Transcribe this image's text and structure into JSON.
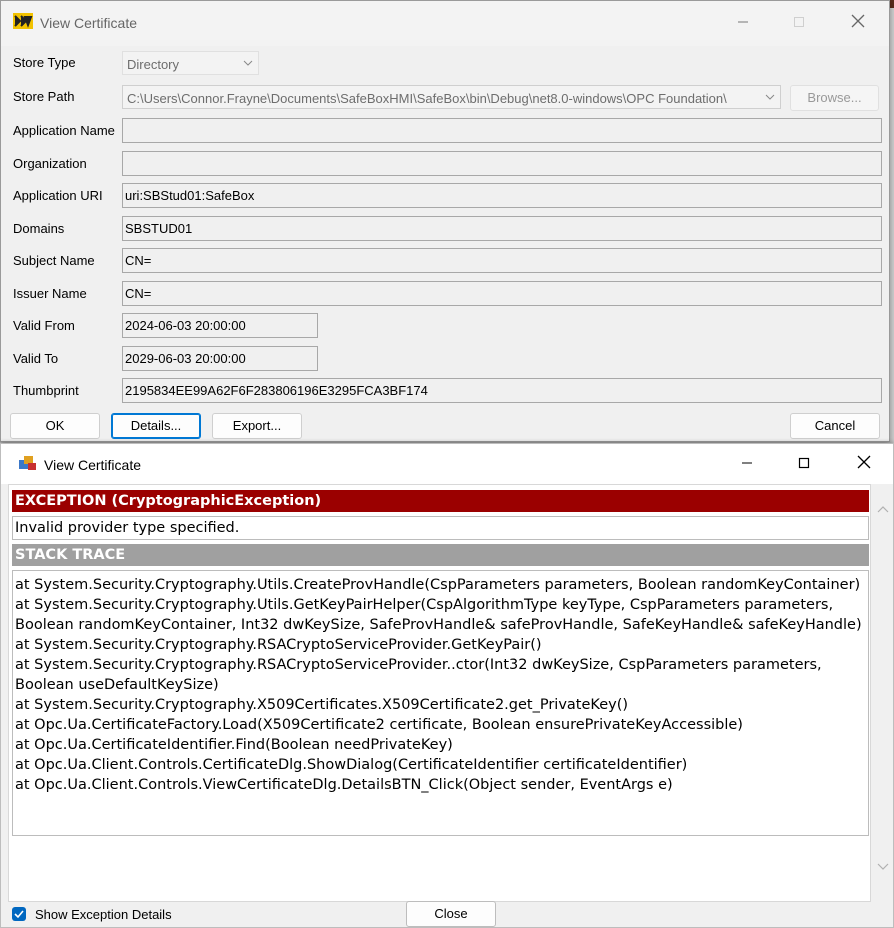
{
  "cert_window": {
    "title": "View Certificate",
    "fields": {
      "store_type": {
        "label": "Store Type",
        "value": "Directory"
      },
      "store_path": {
        "label": "Store Path",
        "value": "C:\\Users\\Connor.Frayne\\Documents\\SafeBoxHMI\\SafeBox\\bin\\Debug\\net8.0-windows\\OPC Foundation\\"
      },
      "application_name": {
        "label": "Application Name",
        "value": ""
      },
      "organization": {
        "label": "Organization",
        "value": ""
      },
      "application_uri": {
        "label": "Application URI",
        "value": "uri:SBStud01:SafeBox"
      },
      "domains": {
        "label": "Domains",
        "value": "SBSTUD01"
      },
      "subject_name": {
        "label": "Subject Name",
        "value": "CN="
      },
      "issuer_name": {
        "label": "Issuer Name",
        "value": "CN="
      },
      "valid_from": {
        "label": "Valid From",
        "value": "2024-06-03 20:00:00"
      },
      "valid_to": {
        "label": "Valid To",
        "value": "2029-06-03 20:00:00"
      },
      "thumbprint": {
        "label": "Thumbprint",
        "value": "2195834EE99A62F6F283806196E3295FCA3BF174"
      }
    },
    "buttons": {
      "browse": "Browse...",
      "ok": "OK",
      "details": "Details...",
      "export": "Export...",
      "cancel": "Cancel"
    }
  },
  "exception_window": {
    "title": "View Certificate",
    "exception_header": "EXCEPTION (CryptographicException)",
    "exception_message": "Invalid provider type specified.",
    "stack_header": "STACK TRACE",
    "stack_lines": [
      "at System.Security.Cryptography.Utils.CreateProvHandle(CspParameters parameters, Boolean randomKeyContainer)",
      "at System.Security.Cryptography.Utils.GetKeyPairHelper(CspAlgorithmType keyType, CspParameters parameters, Boolean randomKeyContainer, Int32 dwKeySize, SafeProvHandle& safeProvHandle, SafeKeyHandle& safeKeyHandle)",
      "at System.Security.Cryptography.RSACryptoServiceProvider.GetKeyPair()",
      "at System.Security.Cryptography.RSACryptoServiceProvider..ctor(Int32 dwKeySize, CspParameters parameters, Boolean useDefaultKeySize)",
      "at System.Security.Cryptography.X509Certificates.X509Certificate2.get_PrivateKey()",
      "at Opc.Ua.CertificateFactory.Load(X509Certificate2 certificate, Boolean ensurePrivateKeyAccessible)",
      "at Opc.Ua.CertificateIdentifier.Find(Boolean needPrivateKey)",
      "at Opc.Ua.Client.Controls.CertificateDlg.ShowDialog(CertificateIdentifier certificateIdentifier)",
      "at Opc.Ua.Client.Controls.ViewCertificateDlg.DetailsBTN_Click(Object sender, EventArgs e)"
    ],
    "show_details_label": "Show Exception Details",
    "show_details_checked": true,
    "close_button": "Close"
  },
  "colors": {
    "exception_header": "#9b0000",
    "stack_header": "#a0a0a0",
    "accent": "#0067c0"
  },
  "icons": [
    "app-icon",
    "minimize-icon",
    "maximize-icon",
    "close-icon",
    "chevron-down-icon",
    "chevron-up-icon",
    "checkmark-icon"
  ]
}
